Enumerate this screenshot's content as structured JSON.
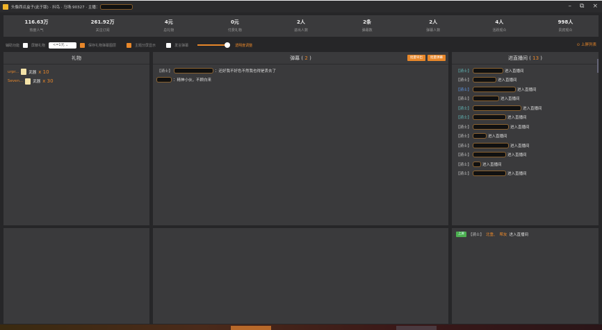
{
  "window": {
    "title": "头像西瓜盒子(此于版) · 抖鸟 · 马场:90327 · 主播："
  },
  "stats": [
    {
      "value": "116.63万",
      "label": "热度人气"
    },
    {
      "value": "261.92万",
      "label": "关注订阅"
    },
    {
      "value": "4元",
      "label": "总礼物"
    },
    {
      "value": "0元",
      "label": "付费礼物"
    },
    {
      "value": "2人",
      "label": "进出人数"
    },
    {
      "value": "2条",
      "label": "弹幕数"
    },
    {
      "value": "2人",
      "label": "弹幕人数"
    },
    {
      "value": "4人",
      "label": "活跃观众"
    },
    {
      "value": "998人",
      "label": "贵宾观众"
    }
  ],
  "controls": {
    "assist": "辅助功能",
    "block_gift": "屏蔽礼物",
    "threshold": "<=1元",
    "save_layer": "保存礼物弹幕图层",
    "split_screen": "主题分屏显示",
    "speak": "发言弹幕",
    "opacity": "透明度调整",
    "top_right": "上屏列表"
  },
  "gifts": {
    "title": "礼物",
    "items": [
      {
        "user": "urpr...",
        "gift": "武器",
        "count": "x 10"
      },
      {
        "user": "Seven...",
        "gift": "武器",
        "count": "x 30"
      }
    ]
  },
  "danmu": {
    "title": "弹幕",
    "count": "2",
    "btn_export": "批量导出",
    "btn_clear": "批量弹幕",
    "items": [
      {
        "tag": "【骑士】",
        "text": "：还好我不好色不然我也得是丢去了"
      },
      {
        "tag": "",
        "text": "：精神小伙，不顾白来"
      }
    ]
  },
  "entries": {
    "title": "进直播间",
    "count": "13",
    "suffix": "进入直播间",
    "tags": [
      "【骑士】",
      "【骑士】",
      "【骑士】",
      "【骑士】",
      "【骑士】",
      "【骑士】",
      "【骑士】",
      "【骑士】",
      "【骑士】",
      "【骑士】",
      "【骑士】",
      "【骑士】"
    ],
    "bottom": {
      "badge": "上屏",
      "tag": "【骑士】",
      "name1": "北重、",
      "name2": "帮友",
      "suffix": "进入直播间"
    }
  }
}
